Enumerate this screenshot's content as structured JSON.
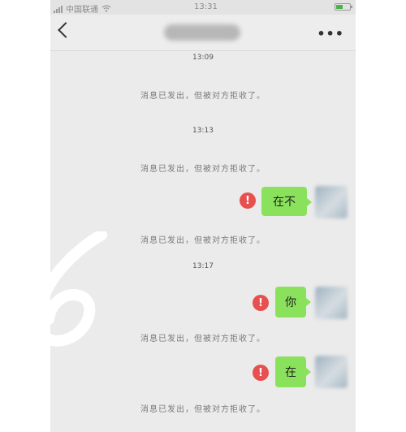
{
  "status_bar": {
    "carrier": "中国联通",
    "time": "13:31"
  },
  "nav": {
    "title": "",
    "more_label": "•••"
  },
  "messages": [
    {
      "type": "timestamp",
      "text": "13:09"
    },
    {
      "type": "system",
      "text": "消息已发出，但被对方拒收了。"
    },
    {
      "type": "timestamp",
      "text": "13:13"
    },
    {
      "type": "system",
      "text": "消息已发出，但被对方拒收了。"
    },
    {
      "type": "sent",
      "text": "在不",
      "status": "error"
    },
    {
      "type": "system",
      "text": "消息已发出，但被对方拒收了。"
    },
    {
      "type": "timestamp",
      "text": "13:17"
    },
    {
      "type": "sent",
      "text": "你",
      "status": "error"
    },
    {
      "type": "system",
      "text": "消息已发出，但被对方拒收了。"
    },
    {
      "type": "sent",
      "text": "在",
      "status": "error"
    },
    {
      "type": "system",
      "text": "消息已发出，但被对方拒收了。"
    }
  ],
  "error_icon": "!",
  "overlay_glyph": "6",
  "colors": {
    "bubble": "#8ae25c",
    "error": "#e85050",
    "background": "#ebebeb"
  }
}
